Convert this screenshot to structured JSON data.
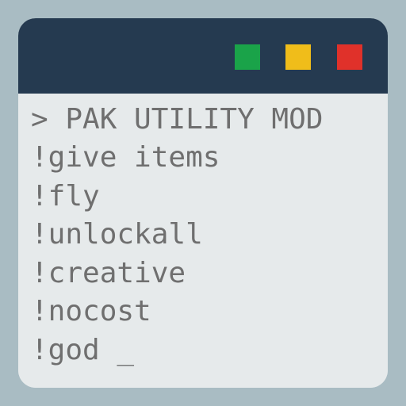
{
  "window": {
    "buttons": [
      {
        "name": "green",
        "color": "#1aa349"
      },
      {
        "name": "yellow",
        "color": "#f0bd1a"
      },
      {
        "name": "red",
        "color": "#e0312a"
      }
    ]
  },
  "console": {
    "header": "> PAK UTILITY MOD",
    "commands": [
      "!give items",
      "!fly",
      "!unlockall",
      "!creative",
      "!nocost",
      "!god"
    ],
    "cursor": "_"
  }
}
